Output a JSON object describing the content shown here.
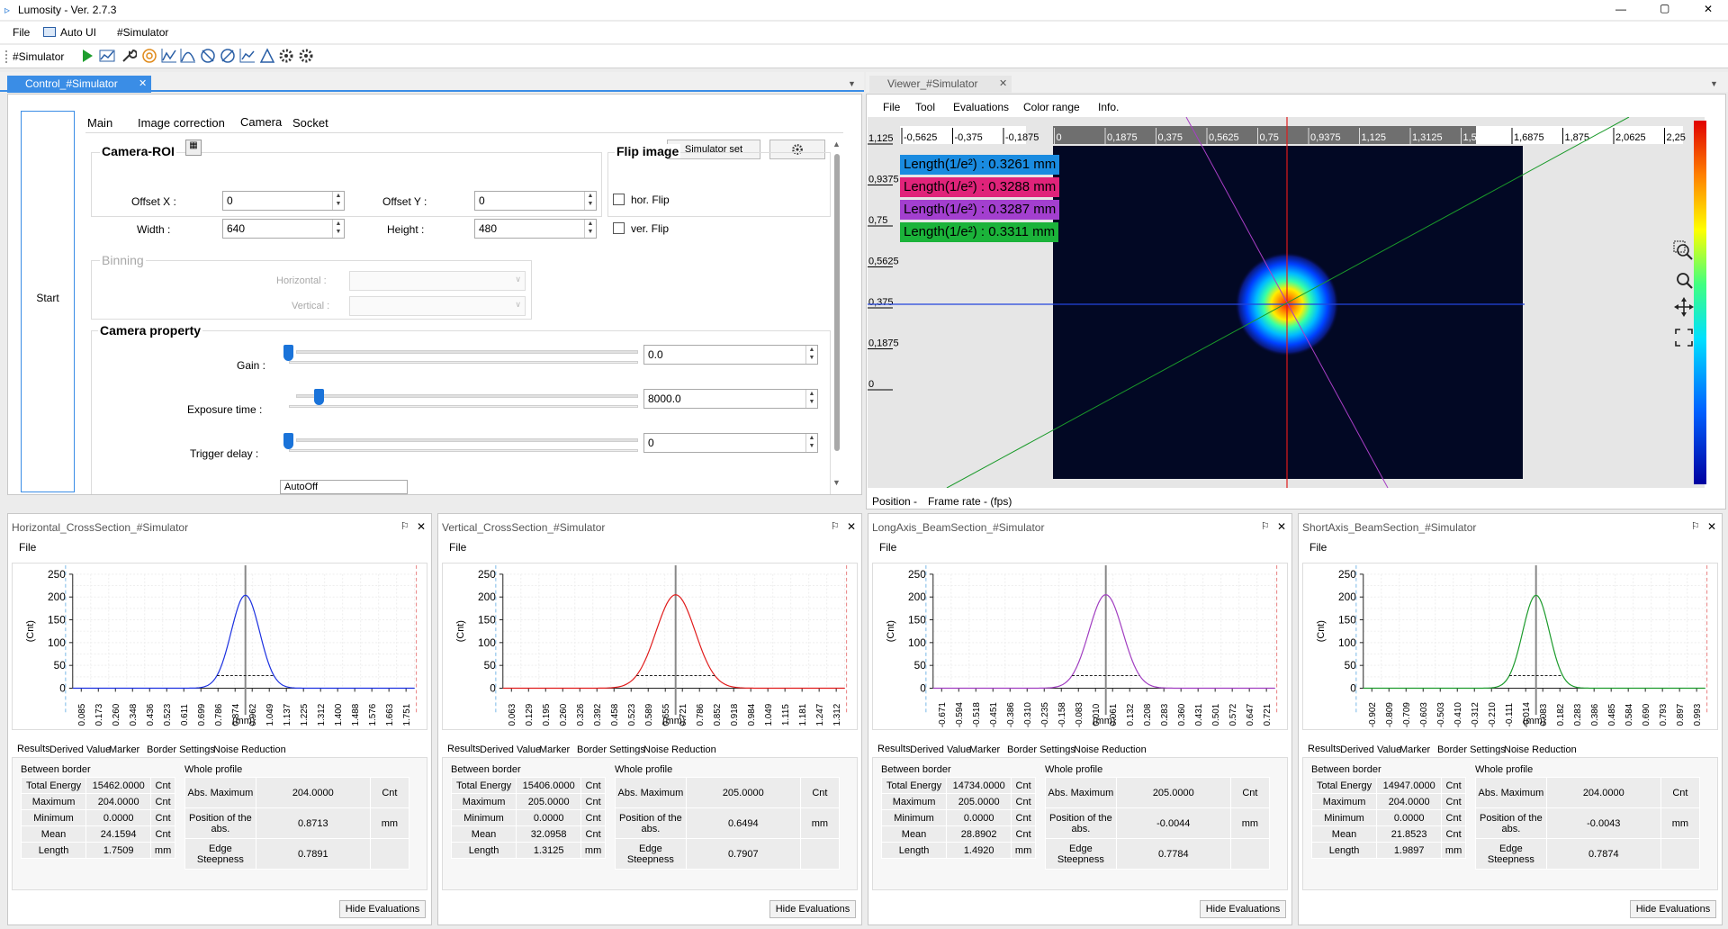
{
  "app": {
    "title": "Lumosity - Ver. 2.7.3",
    "win_min": "—",
    "win_max": "▢",
    "win_close": "✕"
  },
  "menu": {
    "file": "File",
    "auto_ui": "Auto UI",
    "simulator": "#Simulator"
  },
  "toolbar": {
    "simulator_label": "#Simulator"
  },
  "control": {
    "tab": "Control_#Simulator",
    "start": "Start",
    "tabs": [
      "Main",
      "Image correction",
      "Camera",
      "Socket"
    ],
    "simulator_set": "Simulator set",
    "camera_roi": "Camera-ROI",
    "offset_x_label": "Offset X :",
    "offset_x": "0",
    "offset_y_label": "Offset Y :",
    "offset_y": "0",
    "width_label": "Width :",
    "width": "640",
    "height_label": "Height :",
    "height": "480",
    "flip_image": "Flip image",
    "hor_flip": "hor. Flip",
    "ver_flip": "ver. Flip",
    "binning": "Binning",
    "horizontal": "Horizontal :",
    "vertical": "Vertical :",
    "camera_property": "Camera property",
    "gain_label": "Gain :",
    "gain": "0.0",
    "gain_level": 0.0,
    "exposure_label": "Exposure time :",
    "exposure": "8000.0",
    "exposure_level": 0.09,
    "trigger_label": "Trigger delay :",
    "trigger": "0",
    "trigger_level": 0.0,
    "trigger_mode": "AutoOff"
  },
  "viewer": {
    "tab": "Viewer_#Simulator",
    "menu": [
      "File",
      "Tool",
      "Evaluations",
      "Color range",
      "Info."
    ],
    "xticks": [
      "-0,5625",
      "-0,375",
      "-0,1875",
      "0",
      "0,1875",
      "0,375",
      "0,5625",
      "0,75",
      "0,9375",
      "1,125",
      "1,3125",
      "1,5",
      "1,6875",
      "1,875",
      "2,0625",
      "2,25"
    ],
    "yticks": [
      "1,125",
      "0,9375",
      "0,75",
      "0,5625",
      "0,375",
      "0,1875",
      "0"
    ],
    "labels": [
      {
        "text": "Length(1/e²) : 0.3261 mm",
        "color": "#1a8be0"
      },
      {
        "text": "Length(1/e²) : 0.3288 mm",
        "color": "#e0237a"
      },
      {
        "text": "Length(1/e²) : 0.3287 mm",
        "color": "#a33fcf"
      },
      {
        "text": "Length(1/e²) : 0.3311 mm",
        "color": "#1bb33a"
      }
    ],
    "status_position": "Position -",
    "status_frame": "Frame rate - (fps)"
  },
  "panels": [
    {
      "title": "Horizontal_CrossSection_#Simulator",
      "color": "#1a2fe0",
      "xticks": [
        "0.085",
        "0.173",
        "0.260",
        "0.348",
        "0.436",
        "0.523",
        "0.611",
        "0.699",
        "0.786",
        "0.874",
        "0.962",
        "1.049",
        "1.137",
        "1.225",
        "1.312",
        "1.400",
        "1.488",
        "1.576",
        "1.663",
        "1.751"
      ],
      "results": {
        "total_energy": "15462.0000",
        "maximum": "204.0000",
        "minimum": "0.0000",
        "mean": "24.1594",
        "length": "1.7509",
        "abs_max": "204.0000",
        "pos_abs": "0.8713",
        "edge": "0.7891"
      }
    },
    {
      "title": "Vertical_CrossSection_#Simulator",
      "color": "#e01a1a",
      "xticks": [
        "0.063",
        "0.129",
        "0.195",
        "0.260",
        "0.326",
        "0.392",
        "0.458",
        "0.523",
        "0.589",
        "0.655",
        "0.721",
        "0.786",
        "0.852",
        "0.918",
        "0.984",
        "1.049",
        "1.115",
        "1.181",
        "1.247",
        "1.312"
      ],
      "results": {
        "total_energy": "15406.0000",
        "maximum": "205.0000",
        "minimum": "0.0000",
        "mean": "32.0958",
        "length": "1.3125",
        "abs_max": "205.0000",
        "pos_abs": "0.6494",
        "edge": "0.7907"
      }
    },
    {
      "title": "LongAxis_BeamSection_#Simulator",
      "color": "#a03cc0",
      "xticks": [
        "-0.671",
        "-0.594",
        "-0.518",
        "-0.451",
        "-0.386",
        "-0.310",
        "-0.235",
        "-0.158",
        "-0.083",
        "0.010",
        "0.061",
        "0.132",
        "0.208",
        "0.283",
        "0.360",
        "0.431",
        "0.501",
        "0.572",
        "0.647",
        "0.721"
      ],
      "results": {
        "total_energy": "14734.0000",
        "maximum": "205.0000",
        "minimum": "0.0000",
        "mean": "28.8902",
        "length": "1.4920",
        "abs_max": "205.0000",
        "pos_abs": "-0.0044",
        "edge": "0.7784"
      }
    },
    {
      "title": "ShortAxis_BeamSection_#Simulator",
      "color": "#1a9a2a",
      "xticks": [
        "-0.902",
        "-0.809",
        "-0.709",
        "-0.603",
        "-0.503",
        "-0.410",
        "-0.312",
        "-0.210",
        "-0.111",
        "-0.014",
        "0.083",
        "0.182",
        "0.283",
        "0.386",
        "0.485",
        "0.584",
        "0.690",
        "0.793",
        "0.897",
        "0.993"
      ],
      "results": {
        "total_energy": "14947.0000",
        "maximum": "204.0000",
        "minimum": "0.0000",
        "mean": "21.8523",
        "length": "1.9897",
        "abs_max": "204.0000",
        "pos_abs": "-0.0043",
        "edge": "0.7874"
      }
    }
  ],
  "panel_common": {
    "file": "File",
    "yticks": [
      "250",
      "200",
      "150",
      "100",
      "50",
      "0"
    ],
    "ylabel": "(Cnt)",
    "xlabel": "(mm)",
    "result_tabs": [
      "Results",
      "Derived Value",
      "Marker",
      "Border Settings",
      "Noise Reduction"
    ],
    "between_border": "Between border",
    "whole_profile": "Whole profile",
    "total_energy": "Total Energy",
    "maximum": "Maximum",
    "minimum": "Minimum",
    "mean": "Mean",
    "length": "Length",
    "abs_maximum": "Abs. Maximum",
    "position_abs": "Position of the abs.",
    "edge_steepness": "Edge Steepness",
    "cnt": "Cnt",
    "mm": "mm",
    "hide": "Hide Evaluations",
    "pin": "⚐",
    "close": "✕"
  }
}
